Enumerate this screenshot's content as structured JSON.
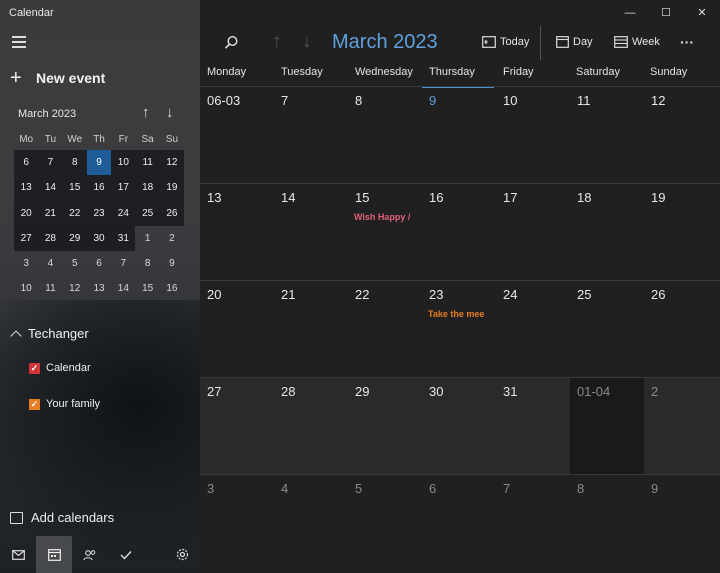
{
  "app": {
    "title": "Calendar"
  },
  "sidebar": {
    "new_event": "New event",
    "mini_calendar": {
      "title": "March 2023",
      "days_of_week": [
        "Mo",
        "Tu",
        "We",
        "Th",
        "Fr",
        "Sa",
        "Su"
      ],
      "weeks": [
        [
          "6",
          "7",
          "8",
          "9",
          "10",
          "11",
          "12"
        ],
        [
          "13",
          "14",
          "15",
          "16",
          "17",
          "18",
          "19"
        ],
        [
          "20",
          "21",
          "22",
          "23",
          "24",
          "25",
          "26"
        ],
        [
          "27",
          "28",
          "29",
          "30",
          "31",
          "1",
          "2"
        ],
        [
          "3",
          "4",
          "5",
          "6",
          "7",
          "8",
          "9"
        ],
        [
          "10",
          "11",
          "12",
          "13",
          "14",
          "15",
          "16"
        ]
      ]
    },
    "account": "Techanger",
    "calendars": [
      {
        "label": "Calendar",
        "color": "#d13438"
      },
      {
        "label": "Your family",
        "color": "#e67e22"
      }
    ],
    "add_calendars": "Add calendars"
  },
  "toolbar": {
    "month_title": "March 2023",
    "today": "Today",
    "day": "Day",
    "week": "Week",
    "more": "···"
  },
  "grid": {
    "days_of_week": [
      "Monday",
      "Tuesday",
      "Wednesday",
      "Thursday",
      "Friday",
      "Saturday",
      "Sunday"
    ],
    "weeks": [
      [
        "06-03",
        "7",
        "8",
        "9",
        "10",
        "11",
        "12"
      ],
      [
        "13",
        "14",
        "15",
        "16",
        "17",
        "18",
        "19"
      ],
      [
        "20",
        "21",
        "22",
        "23",
        "24",
        "25",
        "26"
      ],
      [
        "27",
        "28",
        "29",
        "30",
        "31",
        "01-04",
        "2"
      ],
      [
        "3",
        "4",
        "5",
        "6",
        "7",
        "8",
        "9"
      ]
    ],
    "events": {
      "wish": {
        "label": "Wish Happy /",
        "color": "#e0607a"
      },
      "meeting": {
        "label": "Take the mee",
        "color": "#e67e22"
      }
    }
  },
  "colors": {
    "accent": "#5fa0dd",
    "selected_day": "#1f5d9a"
  }
}
